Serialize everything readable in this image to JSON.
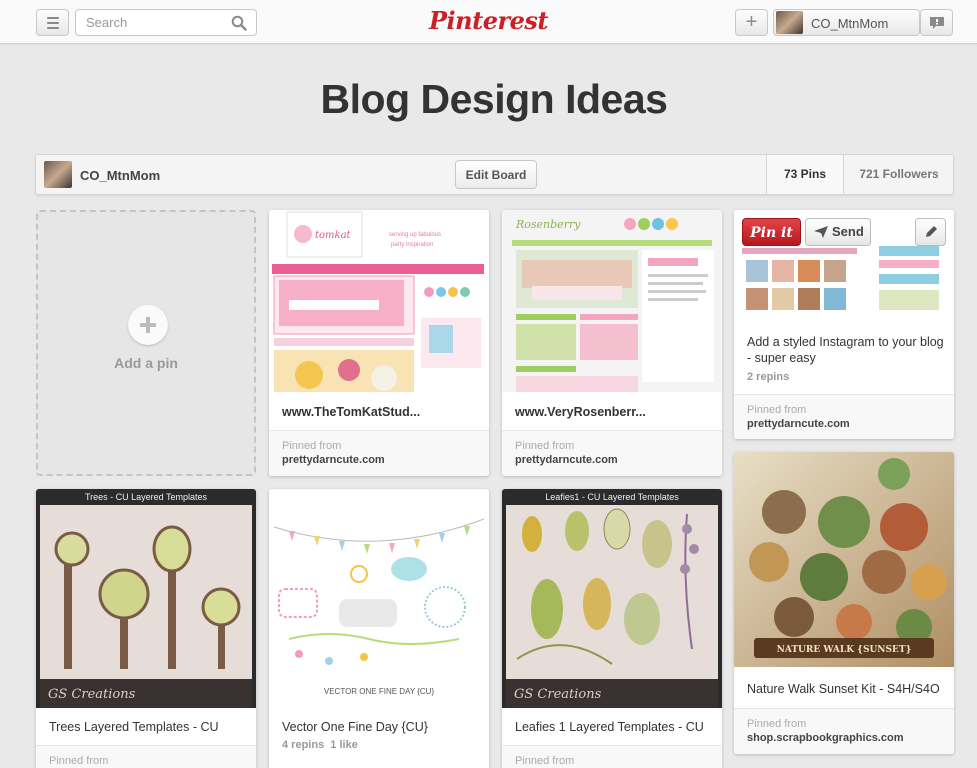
{
  "app": {
    "logo": "Pinterest"
  },
  "topbar": {
    "search_placeholder": "Search",
    "username": "CO_MtnMom"
  },
  "board": {
    "title": "Blog Design Ideas",
    "owner": "CO_MtnMom",
    "edit_label": "Edit Board",
    "pins_count": "73 Pins",
    "followers_count": "721 Followers"
  },
  "add_pin": {
    "label": "Add a pin"
  },
  "pins": [
    {
      "description": "www.TheTomKatStud...",
      "from_label": "Pinned from",
      "source": "prettydarncute.com",
      "image_text": "tomkat"
    },
    {
      "description": "www.VeryRosenberr...",
      "from_label": "Pinned from",
      "source": "prettydarncute.com",
      "image_text": "Rosenberry"
    },
    {
      "description": "Add a styled Instagram to your blog - super easy",
      "stats": "2 repins",
      "from_label": "Pinned from",
      "source": "prettydarncute.com",
      "pinit_label": "Pin it",
      "send_label": "Send"
    },
    {
      "description": "Trees Layered Templates - CU",
      "from_label": "Pinned from",
      "image_title": "Trees - CU Layered Templates",
      "image_brand": "GS Creations"
    },
    {
      "description": "Vector One Fine Day {CU}",
      "stats": "4 repins  1 like",
      "image_caption": "VECTOR ONE FINE DAY {CU}"
    },
    {
      "description": "Leafies 1 Layered Templates - CU",
      "from_label": "Pinned from",
      "image_title": "Leafies1 - CU Layered Templates",
      "image_brand": "GS Creations"
    },
    {
      "description": "Nature Walk Sunset Kit - S4H/S4O",
      "from_label": "Pinned from",
      "source": "shop.scrapbookgraphics.com",
      "image_banner": "NATURE WALK {SUNSET}"
    }
  ],
  "colors": {
    "brand": "#cb2027",
    "background": "#e9e9e9"
  }
}
